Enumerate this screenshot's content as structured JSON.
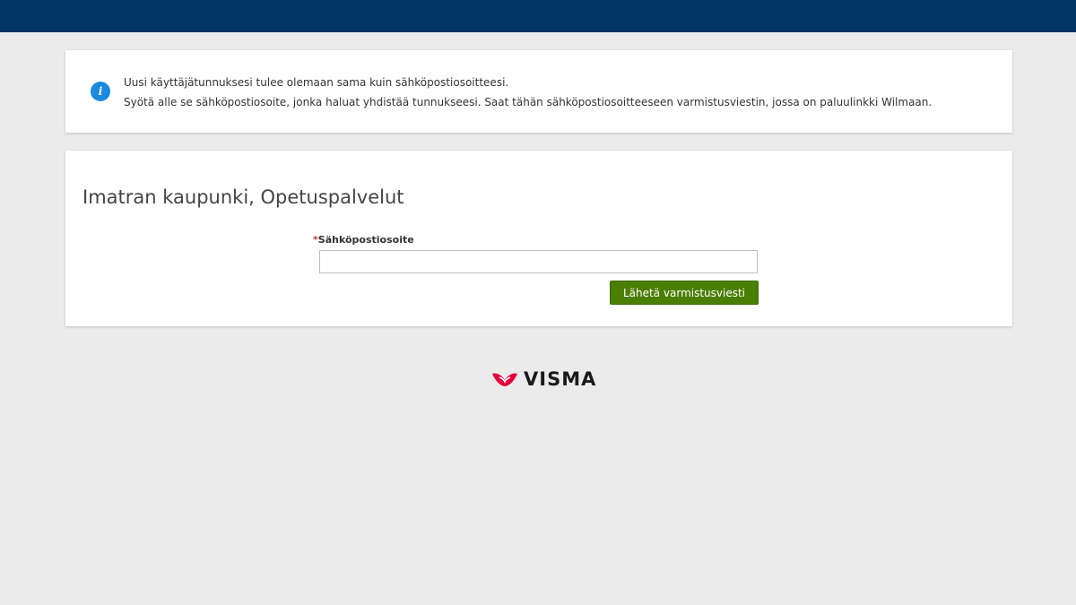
{
  "colors": {
    "header": "#003366",
    "background": "#ebebeb",
    "info_icon": "#1a8ae0",
    "primary_button": "#4a7f06",
    "required_marker": "#c0392b",
    "logo_mark": "#e4003a"
  },
  "info": {
    "icon": "info-icon",
    "line1": "Uusi käyttäjätunnuksesi tulee olemaan sama kuin sähköpostiosoitteesi.",
    "line2": "Syötä alle se sähköpostiosoite, jonka haluat yhdistää tunnukseesi. Saat tähän sähköpostiosoitteeseen varmistusviestin, jossa on paluulinkki Wilmaan."
  },
  "form": {
    "organization": "Imatran kaupunki, Opetuspalvelut",
    "email_label": "Sähköpostiosoite",
    "required_mark": "*",
    "email_value": "",
    "email_placeholder": "",
    "submit_label": "Lähetä varmistusviesti"
  },
  "footer": {
    "logo_text": "VISMA"
  }
}
